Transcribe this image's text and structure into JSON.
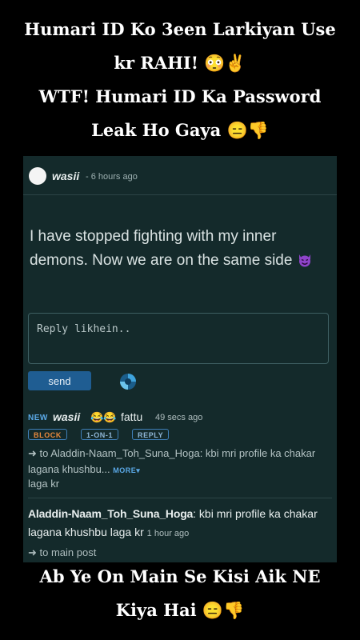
{
  "captions": {
    "top": [
      "Humari ID Ko 3een Larkiyan Use",
      "kr RAHI! 😳✌️",
      "WTF! Humari ID Ka Password",
      "Leak Ho Gaya 😑👎"
    ],
    "bottom": [
      "Ab Ye On Main Se Kisi Aik NE",
      "Kiya Hai 😑👎"
    ]
  },
  "post": {
    "author": "wasii",
    "time": "- 6 hours ago",
    "body": "I have stopped fighting with my inner demons. Now we are on the same side",
    "emoji_icon": "smiling-devil-icon"
  },
  "reply_form": {
    "placeholder": "Reply likhein..",
    "send_label": "send",
    "loader_icon": "spinner-icon"
  },
  "comments": [
    {
      "badge": "NEW",
      "author": "wasii",
      "emojis": "😂😂",
      "name": "fattu",
      "time": "49 secs ago",
      "actions": [
        "BLOCK",
        "1-ON-1",
        "REPLY"
      ],
      "quote_prefix": "➜ to Aladdin-Naam_Toh_Suna_Hoga: kbi mri profile ka chakar lagana khushbu...",
      "more_label": "MORE▾",
      "quote_rest": "laga kr"
    },
    {
      "author": "Aladdin-Naam_Toh_Suna_Hoga",
      "text": ": kbi mri profile ka chakar lagana khushbu laga kr",
      "time": "1 hour ago",
      "link": "➜ to main post"
    }
  ],
  "colors": {
    "background": "#000000",
    "card": "#142a2b",
    "accent_blue": "#1f5d92",
    "block_orange": "#e8893e"
  }
}
